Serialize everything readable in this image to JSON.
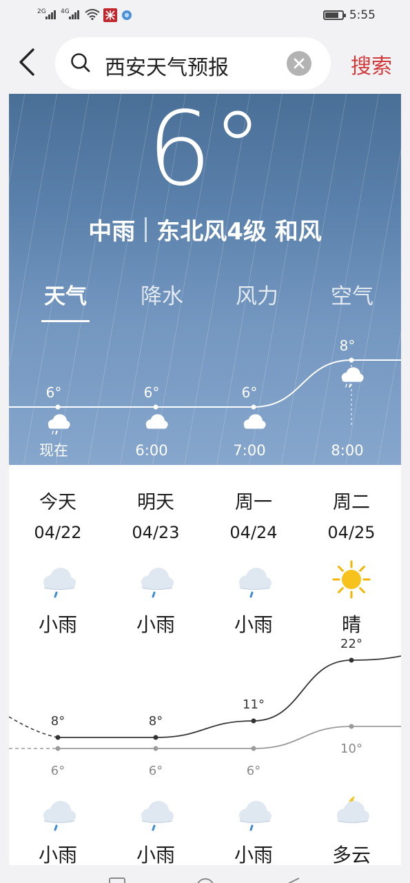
{
  "status_bar": {
    "signal1": "2G",
    "signal2": "4G",
    "time": "5:55",
    "battery_level": 0.8
  },
  "search": {
    "query": "西安天气预报",
    "submit_label": "搜索"
  },
  "current": {
    "temperature": "6°",
    "condition": "中雨",
    "wind": "东北风4级 和风"
  },
  "tabs": [
    {
      "label": "天气",
      "active": true
    },
    {
      "label": "降水",
      "active": false
    },
    {
      "label": "风力",
      "active": false
    },
    {
      "label": "空气",
      "active": false
    }
  ],
  "hourly": [
    {
      "time": "现在",
      "temp": "6°",
      "icon": "cloud-rain-icon"
    },
    {
      "time": "6:00",
      "temp": "6°",
      "icon": "cloud-icon"
    },
    {
      "time": "7:00",
      "temp": "6°",
      "icon": "cloud-icon"
    },
    {
      "time": "8:00",
      "temp": "8°",
      "icon": "cloud-rain-icon"
    }
  ],
  "daily": [
    {
      "day": "今天",
      "date": "04/22",
      "day_cond": "小雨",
      "day_icon": "cloud-rain-icon",
      "high": "8°",
      "low": "6°",
      "night_cond": "小雨",
      "night_icon": "cloud-rain-icon"
    },
    {
      "day": "明天",
      "date": "04/23",
      "day_cond": "小雨",
      "day_icon": "cloud-rain-icon",
      "high": "8°",
      "low": "6°",
      "night_cond": "小雨",
      "night_icon": "cloud-rain-icon"
    },
    {
      "day": "周一",
      "date": "04/24",
      "day_cond": "小雨",
      "day_icon": "cloud-rain-icon",
      "high": "11°",
      "low": "6°",
      "night_cond": "小雨",
      "night_icon": "cloud-rain-icon"
    },
    {
      "day": "周二",
      "date": "04/25",
      "day_cond": "晴",
      "day_icon": "sun-icon",
      "high": "22°",
      "low": "10°",
      "night_cond": "多云",
      "night_icon": "moon-cloud-icon"
    }
  ],
  "colors": {
    "accent": "#d23a3a",
    "hero_top": "#4a6f97",
    "hero_bottom": "#86a6cc",
    "high_line": "#333333",
    "low_line": "#9a9a9a"
  },
  "chart_data": [
    {
      "type": "line",
      "categories": [
        "现在",
        "6:00",
        "7:00",
        "8:00"
      ],
      "series": [
        {
          "values": [
            6,
            6,
            6,
            8
          ]
        }
      ]
    },
    {
      "type": "line",
      "categories": [
        "04/22",
        "04/23",
        "04/24",
        "04/25"
      ],
      "series": [
        {
          "values": [
            8,
            8,
            11,
            22
          ]
        },
        {
          "values": [
            6,
            6,
            6,
            10
          ]
        }
      ]
    }
  ]
}
